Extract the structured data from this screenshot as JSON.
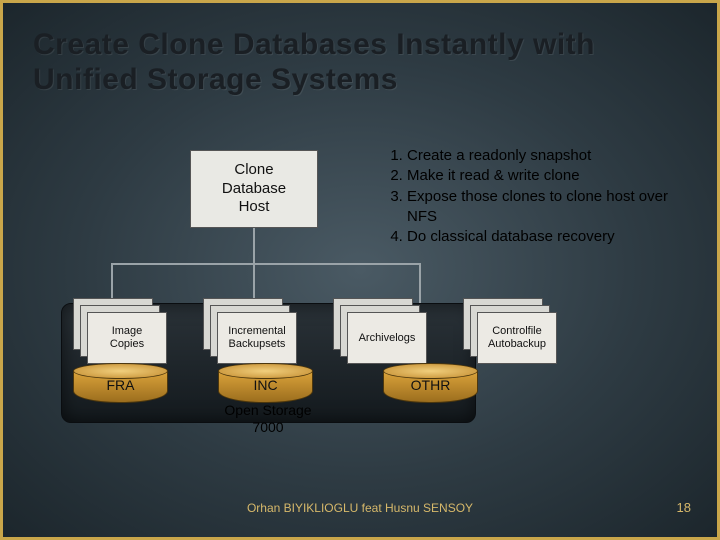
{
  "title": "Create Clone Databases Instantly with Unified Storage Systems",
  "clone_host": "Clone\nDatabase\nHost",
  "steps": [
    "Create a readonly snapshot",
    "Make it read & write clone",
    "Expose those clones to clone host over NFS",
    "Do classical database recovery"
  ],
  "stacks": {
    "image_copies": "Image\nCopies",
    "incremental_backupsets": "Incremental\nBackupsets",
    "archivelogs": "Archivelogs",
    "controlfile_autobackup": "Controlfile\nAutobackup"
  },
  "cylinders": {
    "fra": "FRA",
    "inc": "INC",
    "othr": "OTHR"
  },
  "chassis_label": "Open Storage\n7000",
  "footer_center": "Orhan BIYIKLIOGLU feat Husnu SENSOY",
  "page_number": "18"
}
